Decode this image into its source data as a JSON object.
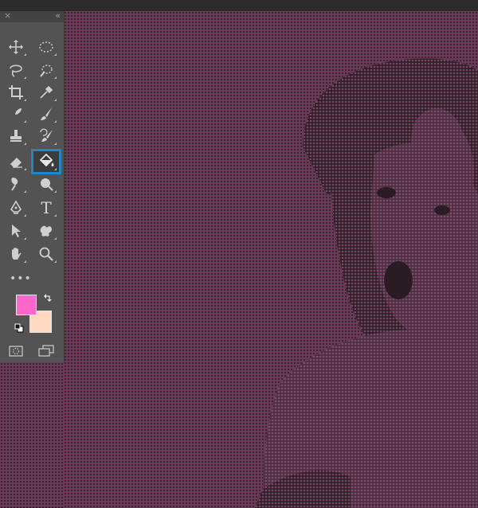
{
  "app": {
    "panel_close_symbol": "×",
    "panel_collapse_symbol": "«"
  },
  "toolbar": {
    "tools": [
      {
        "name": "move-tool",
        "icon": "move-icon"
      },
      {
        "name": "marquee-tool",
        "icon": "elliptical-marquee-icon"
      },
      {
        "name": "lasso-tool",
        "icon": "lasso-icon"
      },
      {
        "name": "quick-selection-tool",
        "icon": "quick-selection-icon"
      },
      {
        "name": "crop-tool",
        "icon": "crop-icon"
      },
      {
        "name": "eyedropper-tool",
        "icon": "eyedropper-icon"
      },
      {
        "name": "healing-brush-tool",
        "icon": "healing-brush-icon"
      },
      {
        "name": "brush-tool",
        "icon": "brush-icon"
      },
      {
        "name": "clone-stamp-tool",
        "icon": "clone-stamp-icon"
      },
      {
        "name": "history-brush-tool",
        "icon": "history-brush-icon"
      },
      {
        "name": "eraser-tool",
        "icon": "eraser-icon"
      },
      {
        "name": "paint-bucket-tool",
        "icon": "paint-bucket-icon",
        "selected": true
      },
      {
        "name": "smudge-tool",
        "icon": "smudge-icon"
      },
      {
        "name": "dodge-tool",
        "icon": "dodge-icon"
      },
      {
        "name": "pen-tool",
        "icon": "pen-icon"
      },
      {
        "name": "type-tool",
        "icon": "type-icon",
        "glyph": "T"
      },
      {
        "name": "path-selection-tool",
        "icon": "path-selection-icon"
      },
      {
        "name": "custom-shape-tool",
        "icon": "custom-shape-icon"
      },
      {
        "name": "hand-tool",
        "icon": "hand-icon"
      },
      {
        "name": "zoom-tool",
        "icon": "zoom-icon"
      }
    ],
    "more_tools_label": "•••",
    "foreground_color": "#ff66cc",
    "background_color": "#ffd9c2",
    "selection_outline_color": "#1f86c9"
  },
  "canvas": {
    "image": "halftone-portrait-woman-hat",
    "tint_color": "#6b3a56",
    "dot_color": "#3a2534"
  }
}
